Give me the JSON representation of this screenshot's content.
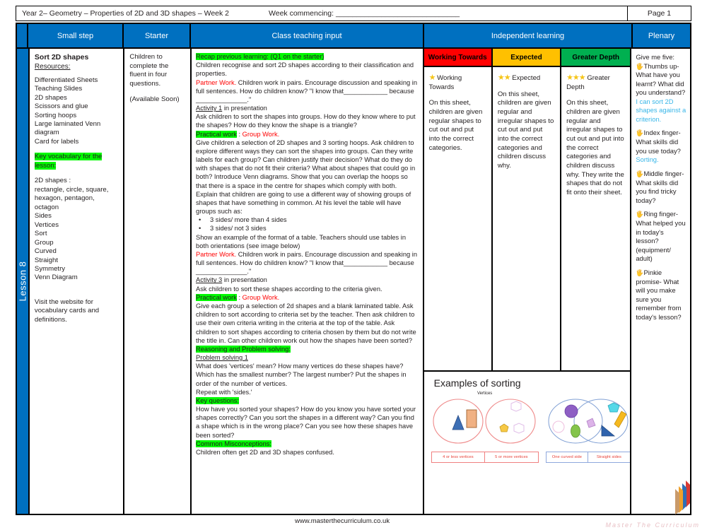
{
  "header_bar": {
    "left_title": "Year 2– Geometry – Properties of 2D and 3D shapes – Week 2",
    "week_commencing": "Week commencing: ______________________________",
    "page_label": "Page 1"
  },
  "columns": [
    {
      "label": "Small step"
    },
    {
      "label": "Starter"
    },
    {
      "label": "Class teaching input"
    },
    {
      "label": "Independent learning"
    },
    {
      "label": "Plenary"
    }
  ],
  "spine": {
    "label": "Lesson 8"
  },
  "small_step": {
    "title": "Sort 2D shapes",
    "resources_label": "Resources:",
    "resources": [
      "Differentiated Sheets",
      "Teaching Slides",
      "2D shapes",
      "Scissors and glue",
      "Sorting hoops",
      "Large laminated Venn diagram",
      "Card for labels"
    ],
    "key_vocab_label": "Key vocabulary for the lesson:",
    "vocab": [
      "2D shapes :",
      "rectangle, circle, square, hexagon, pentagon, octagon",
      "Sides",
      "Vertices",
      "Sort",
      "Group",
      "Curved",
      "Straight",
      "Symmetry",
      "Venn Diagram"
    ],
    "footer_note": "Visit the website for vocabulary cards and definitions."
  },
  "starter": {
    "text": "Children to complete the fluent in four questions.",
    "availability": "(Available Soon)"
  },
  "class_input": {
    "recap_heading": "Recap previous learning: (Q1 on the starter)",
    "recap_text": "Children recognise and sort 2D shapes according to their classification and  properties.",
    "partner_work_label_1": "Partner Work.",
    "partner_work_text_1": " Children work in pairs. Encourage discussion and speaking in full sentences. How do children know?  \"I know that____________ because ______________.\"",
    "activity1_label": "Activity 1",
    "activity1_suffix": " in presentation",
    "activity1_text": "Ask children to sort the shapes into groups. How do they know where to put the shapes? How do they know the shape is a triangle?",
    "practical_label_1": "Practical work",
    "practical_sep_1": " : ",
    "group_work_1": "Group Work.",
    "practical_text_1": "Give children a selection of 2D shapes and 3 sorting hoops. Ask children to explore different ways they can sort the shapes into groups. Can they write labels for each group? Can children justify their decision? What do they do with shapes that do not fit their criteria? What about shapes that could go in both? Introduce Venn diagrams. Show that you can overlap the hoops so that there is a space in the centre for shapes which comply with both.",
    "explain_text": "Explain that children are going to use a different way of showing groups of shapes that have something in common. At his level the table will have groups such as:",
    "bullets": [
      "3 sides/ more than 4 sides",
      "3 sides/ not 3 sides"
    ],
    "table_text": "Show an example of the format of a table. Teachers should use tables in both orientations (see image below)",
    "partner_work_label_2": "Partner Work.",
    "partner_work_text_2": " Children work in pairs. Encourage discussion and speaking in full sentences. How do children know?  \"I know that____________ because ______________.\"",
    "activity3_label": "Activity 3",
    "activity3_suffix": " in presentation",
    "activity3_text": "Ask children to sort these shapes according to the criteria given.",
    "practical_label_2": "Practical work",
    "practical_sep_2": " : ",
    "group_work_2": "Group Work.",
    "practical_text_2": "Give each group a selection of 2d shapes and a blank laminated table. Ask children to sort according to criteria set by the teacher. Then ask children to use their own criteria writing in the criteria at the top of the table. Ask children to sort shapes according to criteria chosen by them but do not write the title in. Can other children work out how the shapes have been sorted?",
    "reasoning_heading": "Reasoning and Problem solving:",
    "problem_solving_label": "Problem solving 1",
    "problem_solving_text": "What does 'vertices' mean? How many vertices do these shapes have? Which has the smallest number? The largest number? Put the shapes in order of the number of vertices.",
    "repeat_text": "Repeat with 'sides.'",
    "key_questions_heading": "Key questions:",
    "key_questions_text": "How have you sorted your shapes? How do you know you have sorted your shapes correctly? Can you sort the shapes in a different way? Can you find a shape which is in the wrong place? Can you see how these shapes have been sorted?",
    "misconceptions_heading": "Common Misconceptions:",
    "misconceptions_text": "Children often get 2D and 3D shapes confused."
  },
  "independent": {
    "levels": [
      {
        "header": "Working Towards",
        "header_bg": "#ff0000",
        "stars": 1,
        "star_label": "Working Towards",
        "body": "On this sheet, children are given regular shapes to cut out and put into the correct categories."
      },
      {
        "header": "Expected",
        "header_bg": "#ffc000",
        "stars": 2,
        "star_label": "Expected",
        "body": "On this sheet, children are given regular and irregular shapes to cut out and put into the correct categories and children discuss why."
      },
      {
        "header": "Greater Depth",
        "header_bg": "#00b050",
        "stars": 3,
        "star_label": "Greater Depth",
        "body": "On this sheet, children are given regular and irregular shapes to cut out and put into the correct categories and children discuss why. They write the shapes that do not fit onto their sheet."
      }
    ],
    "examples": {
      "title": "Examples of sorting",
      "left_caption": "Vertices",
      "left_labels": [
        "4 or less vertices",
        "5 or more vertices"
      ],
      "right_labels": [
        "One curved side",
        "Straight sides"
      ]
    }
  },
  "plenary": {
    "intro": "Give me five:",
    "items": [
      {
        "prompt": "Thumbs up- What have you learnt? What did you understand?",
        "answer": "I can sort 2D shapes against a criterion."
      },
      {
        "prompt": "Index finger- What skills did you use today?",
        "answer": "Sorting."
      },
      {
        "prompt": "Middle finger- What skills did you find tricky today?",
        "answer": ""
      },
      {
        "prompt": "Ring finger- What helped you in today's lesson? (equipment/ adult)",
        "answer": ""
      },
      {
        "prompt": "Pinkie promise- What will you make sure you remember from today's lesson?",
        "answer": ""
      }
    ]
  },
  "footer": {
    "url": "www.masterthecurriculum.co.uk",
    "brand": "Master  The  Curriculum"
  },
  "colors": {
    "header_blue": "#0070c0",
    "highlight_green": "#00f900",
    "red_text": "#ff0000",
    "blue_note": "#38b6e8",
    "working_towards": "#ff0000",
    "expected": "#ffc000",
    "greater_depth": "#00b050"
  }
}
